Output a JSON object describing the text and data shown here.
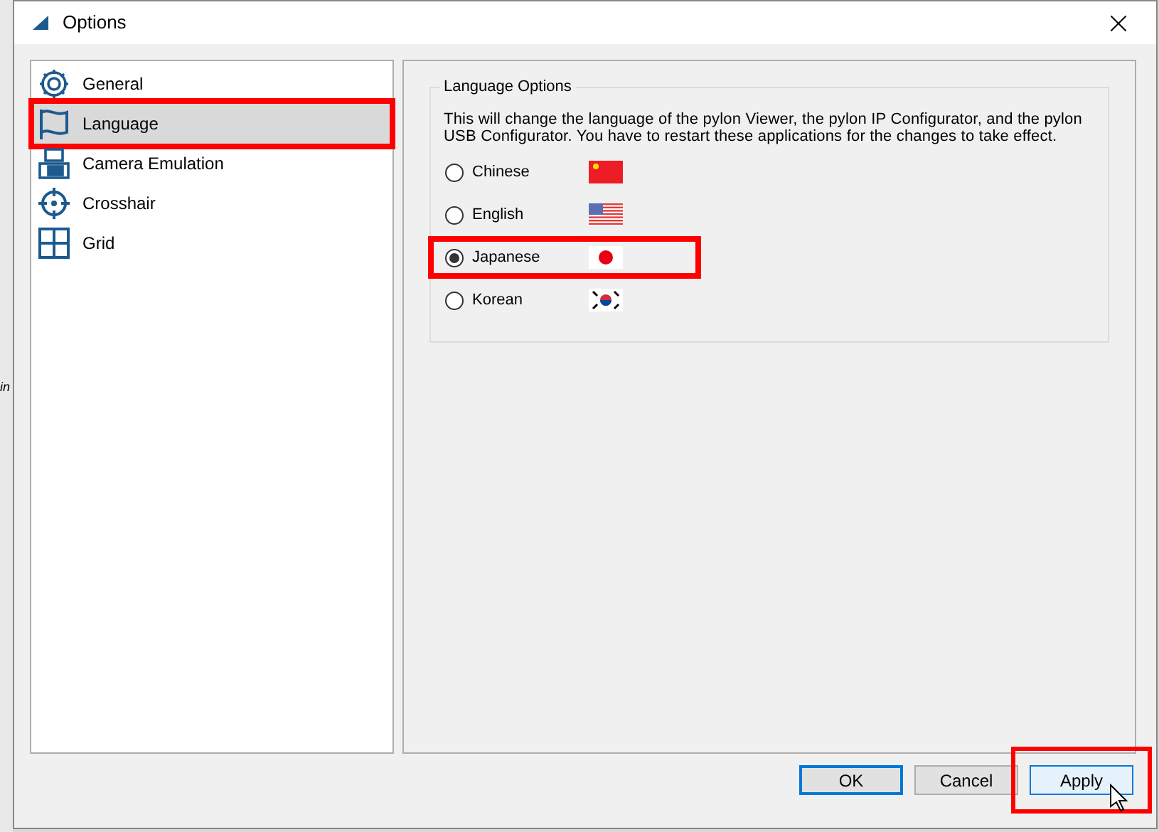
{
  "background": {
    "text": "in"
  },
  "window": {
    "title": "Options"
  },
  "sidebar": {
    "items": [
      {
        "label": "General",
        "selected": false,
        "highlighted": false
      },
      {
        "label": "Language",
        "selected": true,
        "highlighted": true
      },
      {
        "label": "Camera Emulation",
        "selected": false,
        "highlighted": false
      },
      {
        "label": "Crosshair",
        "selected": false,
        "highlighted": false
      },
      {
        "label": "Grid",
        "selected": false,
        "highlighted": false
      }
    ]
  },
  "group": {
    "title": "Language Options",
    "description": "This will change the language of the pylon Viewer, the pylon IP Configurator, and the pylon USB Configurator. You have to restart these applications for the changes to take effect.",
    "options": [
      {
        "label": "Chinese",
        "selected": false,
        "highlighted": false
      },
      {
        "label": "English",
        "selected": false,
        "highlighted": false
      },
      {
        "label": "Japanese",
        "selected": true,
        "highlighted": true
      },
      {
        "label": "Korean",
        "selected": false,
        "highlighted": false
      }
    ]
  },
  "buttons": [
    {
      "label": "OK",
      "kind": "default",
      "highlighted": false
    },
    {
      "label": "Cancel",
      "kind": "normal",
      "highlighted": false
    },
    {
      "label": "Apply",
      "kind": "hover",
      "highlighted": true
    }
  ]
}
